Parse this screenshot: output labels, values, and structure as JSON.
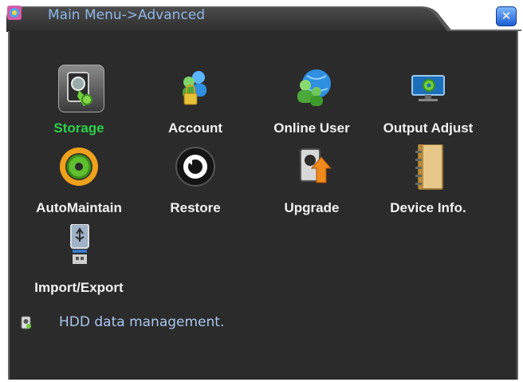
{
  "window": {
    "title": "Main Menu->Advanced",
    "close_icon": "close-icon"
  },
  "menu": {
    "items": [
      {
        "label": "Storage",
        "icon": "hdd-storage-icon",
        "selected": true
      },
      {
        "label": "Account",
        "icon": "users-lock-icon"
      },
      {
        "label": "Online User",
        "icon": "users-globe-icon"
      },
      {
        "label": "Output Adjust",
        "icon": "monitor-gear-icon"
      },
      {
        "label": "AutoMaintain",
        "icon": "gear-cycle-icon"
      },
      {
        "label": "Restore",
        "icon": "restore-icon"
      },
      {
        "label": "Upgrade",
        "icon": "upgrade-icon"
      },
      {
        "label": "Device Info.",
        "icon": "notebook-icon"
      },
      {
        "label": "Import/Export",
        "icon": "usb-drive-icon"
      }
    ]
  },
  "status": {
    "text": "HDD data management."
  },
  "colors": {
    "panel_bg": "#2b2b2b",
    "selected_label": "#2bd14a",
    "title_text": "#8fb6e6",
    "status_text": "#a9c6ee"
  }
}
